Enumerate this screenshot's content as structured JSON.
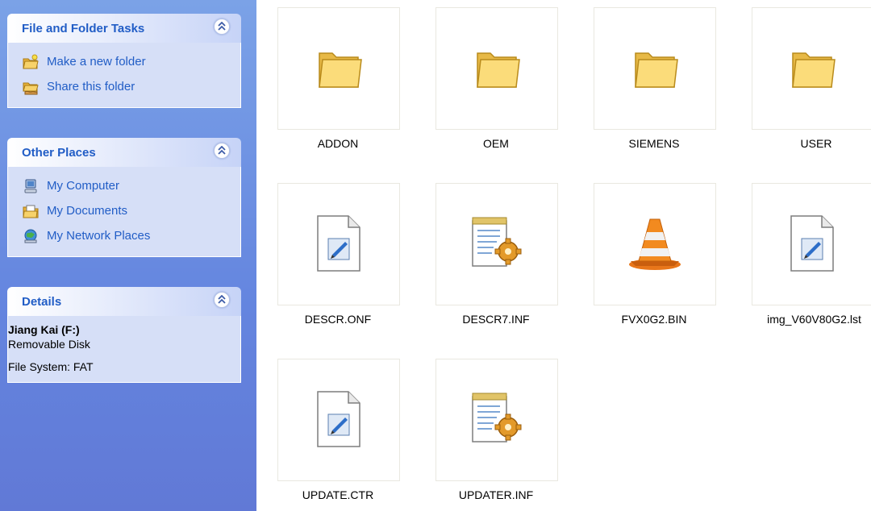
{
  "task_pane": {
    "file_tasks": {
      "title": "File and Folder Tasks",
      "items": [
        {
          "label": "Make a new folder",
          "icon": "new-folder-icon"
        },
        {
          "label": "Share this folder",
          "icon": "share-folder-icon"
        }
      ]
    },
    "other_places": {
      "title": "Other Places",
      "items": [
        {
          "label": "My Computer",
          "icon": "my-computer-icon"
        },
        {
          "label": "My Documents",
          "icon": "my-documents-icon"
        },
        {
          "label": "My Network Places",
          "icon": "network-places-icon"
        }
      ]
    },
    "details": {
      "title": "Details",
      "name": "Jiang Kai (F:)",
      "type": "Removable Disk",
      "file_system": "File System: FAT"
    }
  },
  "files": [
    {
      "name": "ADDON",
      "icon": "folder-icon"
    },
    {
      "name": "OEM",
      "icon": "folder-icon"
    },
    {
      "name": "SIEMENS",
      "icon": "folder-icon"
    },
    {
      "name": "USER",
      "icon": "folder-icon"
    },
    {
      "name": "DESCR.ONF",
      "icon": "generic-file-icon"
    },
    {
      "name": "DESCR7.INF",
      "icon": "setup-info-file-icon"
    },
    {
      "name": "FVX0G2.BIN",
      "icon": "vlc-cone-icon"
    },
    {
      "name": "img_V60V80G2.lst",
      "icon": "generic-file-icon"
    },
    {
      "name": "UPDATE.CTR",
      "icon": "generic-file-icon"
    },
    {
      "name": "UPDATER.INF",
      "icon": "setup-info-file-icon"
    }
  ],
  "colors": {
    "pane_link": "#215dc6",
    "pane_bg": "#6485df",
    "group_body": "#d6dff7"
  }
}
